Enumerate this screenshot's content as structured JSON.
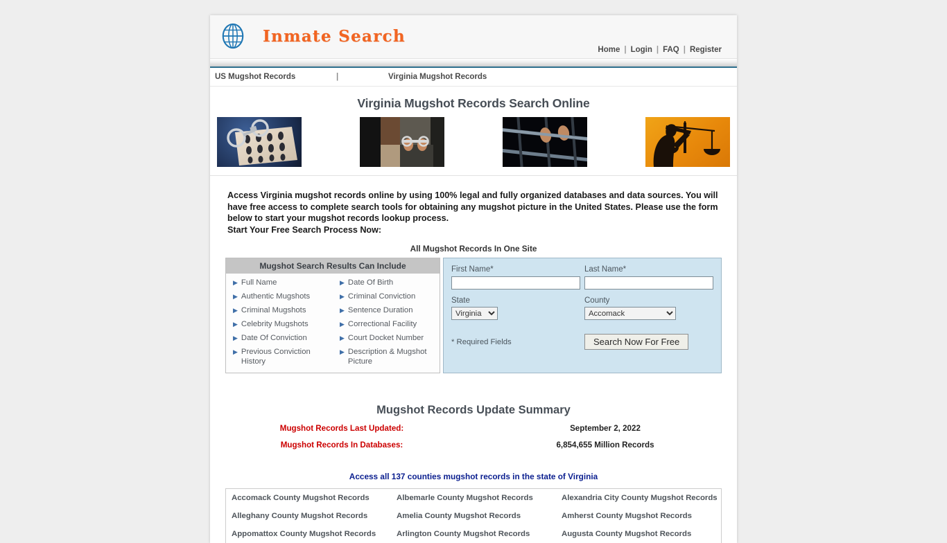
{
  "header": {
    "logo_text": "Inmate Search",
    "logo_icon": "globe-icon",
    "nav": [
      {
        "label": "Home"
      },
      {
        "label": "Login"
      },
      {
        "label": "FAQ"
      },
      {
        "label": "Register"
      }
    ],
    "nav_separator": "|"
  },
  "breadcrumb": {
    "item1": "US Mugshot Records",
    "separator": "|",
    "item2": "Virginia Mugshot Records"
  },
  "page_title": "Virginia Mugshot Records Search Online",
  "images": [
    {
      "name": "handcuffs-fingerprint-card-image"
    },
    {
      "name": "handcuffed-person-image"
    },
    {
      "name": "hands-on-jail-bars-image"
    },
    {
      "name": "lady-justice-scales-image"
    }
  ],
  "intro": {
    "line1": "Access Virginia mugshot records online by using 100% legal and fully organized databases and data sources. You will have free access to complete search tools for obtaining any mugshot picture in the United States. Please use the form below to start your mugshot records lookup process.",
    "line2": "Start Your Free Search Process Now:",
    "subhead": "All Mugshot Records In One Site"
  },
  "features": {
    "title": "Mugshot Search Results Can Include",
    "left": [
      "Full Name",
      "Authentic Mugshots",
      "Criminal Mugshots",
      "Celebrity Mugshots",
      "Date Of Conviction",
      "Previous Conviction History"
    ],
    "right": [
      "Date Of Birth",
      "Criminal Conviction",
      "Sentence Duration",
      "Correctional Facility",
      "Court Docket Number",
      "Description & Mugshot Picture"
    ]
  },
  "search_form": {
    "first_name_label": "First Name*",
    "first_name_value": "",
    "first_name_placeholder": "",
    "last_name_label": "Last Name*",
    "last_name_value": "",
    "last_name_placeholder": "",
    "state_label": "State",
    "state_value": "Virginia",
    "state_options": [
      "Virginia"
    ],
    "county_label": "County",
    "county_value": "Accomack",
    "county_options": [
      "Accomack"
    ],
    "required_note": "* Required Fields",
    "submit_label": "Search Now For Free"
  },
  "summary": {
    "title": "Mugshot Records Update Summary",
    "rows": [
      {
        "label": "Mugshot Records Last Updated:",
        "value": "September 2, 2022"
      },
      {
        "label": "Mugshot Records In Databases:",
        "value": "6,854,655 Million Records"
      }
    ],
    "counties_note": "Access all 137 counties mugshot records in the state of Virginia"
  },
  "counties": [
    [
      "Accomack County Mugshot Records",
      "Albemarle County Mugshot Records",
      "Alexandria City County Mugshot Records"
    ],
    [
      "Alleghany County Mugshot Records",
      "Amelia County Mugshot Records",
      "Amherst County Mugshot Records"
    ],
    [
      "Appomattox County Mugshot Records",
      "Arlington County Mugshot Records",
      "Augusta County Mugshot Records"
    ]
  ],
  "colors": {
    "logo_orange": "#f26522",
    "divider_blue": "#2e6f8e",
    "form_blue": "#cfe4f0",
    "label_red": "#cc0000",
    "link_blue": "#0b1f8f",
    "bullet_blue": "#3f6fa8"
  }
}
